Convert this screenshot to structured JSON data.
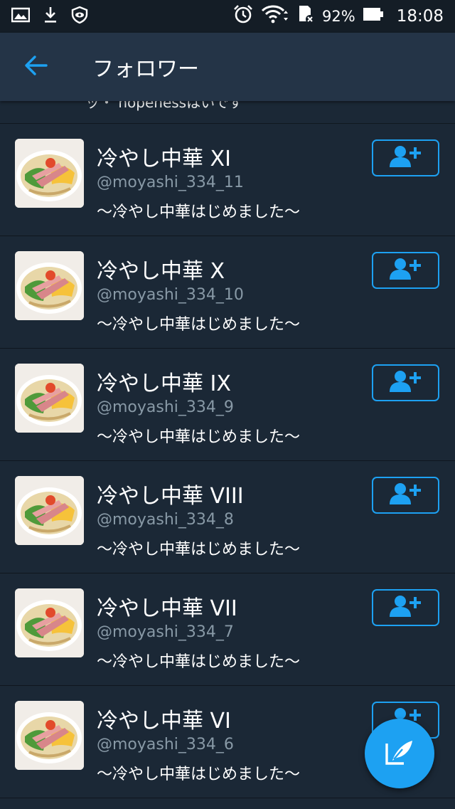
{
  "status_bar": {
    "battery_percent": "92%",
    "time": "18:08",
    "left_icons": [
      "gallery-icon",
      "download-icon",
      "shield-eye-icon"
    ],
    "right_icons": [
      "alarm-icon",
      "wifi-icon",
      "sd-card-icon",
      "battery-icon"
    ]
  },
  "app_bar": {
    "title": "フォロワー",
    "back_icon": "arrow-left-icon"
  },
  "colors": {
    "accent": "#1da1f2",
    "background": "#1b2836",
    "app_bar": "#243447",
    "status_bar": "#141d26",
    "secondary_text": "#8899a6"
  },
  "list": {
    "partial_top_text": "ッ・ hopenessはいです",
    "users": [
      {
        "name": "冷やし中華 XI",
        "handle": "@moyashi_334_11",
        "bio": "〜冷やし中華はじめました〜"
      },
      {
        "name": "冷やし中華 X",
        "handle": "@moyashi_334_10",
        "bio": "〜冷やし中華はじめました〜"
      },
      {
        "name": "冷やし中華 IX",
        "handle": "@moyashi_334_9",
        "bio": "〜冷やし中華はじめました〜"
      },
      {
        "name": "冷やし中華 VIII",
        "handle": "@moyashi_334_8",
        "bio": "〜冷やし中華はじめました〜"
      },
      {
        "name": "冷やし中華 VII",
        "handle": "@moyashi_334_7",
        "bio": "〜冷やし中華はじめました〜"
      },
      {
        "name": "冷やし中華 VI",
        "handle": "@moyashi_334_6",
        "bio": "〜冷やし中華はじめました〜"
      }
    ]
  },
  "fab": {
    "icon": "compose-tweet-icon"
  }
}
